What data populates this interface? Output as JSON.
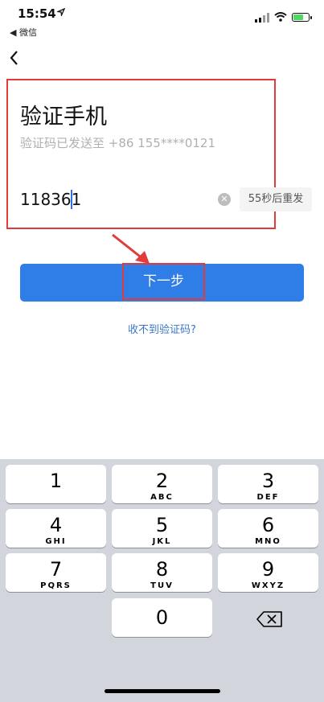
{
  "status_bar": {
    "time": "15:54",
    "location_icon": "location-arrow-icon",
    "back_app": "◀ 微信",
    "signal_icon": "cellular-signal-icon",
    "wifi_icon": "wifi-icon",
    "battery_icon": "battery-charging-icon"
  },
  "nav": {
    "back_icon": "chevron-left-icon"
  },
  "page": {
    "title": "验证手机",
    "subtitle": "验证码已发送至 +86 155****0121",
    "code_value": "118361",
    "clear_icon": "clear-circle-icon",
    "resend_label": "55秒后重发",
    "next_label": "下一步",
    "no_code_link": "收不到验证码?"
  },
  "keyboard": {
    "keys": [
      {
        "num": "1",
        "letters": ""
      },
      {
        "num": "2",
        "letters": "ABC"
      },
      {
        "num": "3",
        "letters": "DEF"
      },
      {
        "num": "4",
        "letters": "GHI"
      },
      {
        "num": "5",
        "letters": "JKL"
      },
      {
        "num": "6",
        "letters": "MNO"
      },
      {
        "num": "7",
        "letters": "PQRS"
      },
      {
        "num": "8",
        "letters": "TUV"
      },
      {
        "num": "9",
        "letters": "WXYZ"
      },
      {
        "num": "0",
        "letters": ""
      }
    ],
    "delete_icon": "backspace-icon"
  },
  "colors": {
    "primary": "#2f7de6",
    "highlight": "#e23b3b",
    "link": "#3a77c8",
    "keyboard_bg": "#d2d5db"
  }
}
